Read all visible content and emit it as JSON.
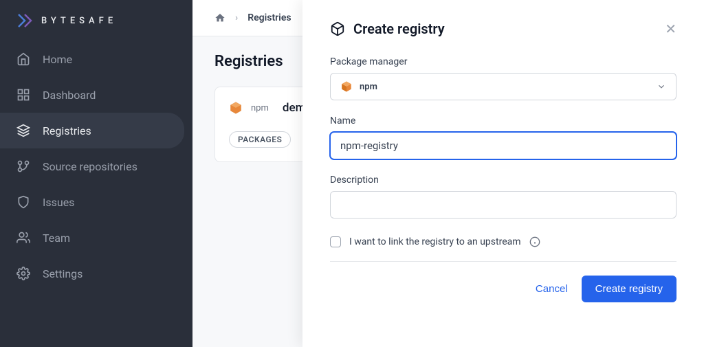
{
  "brand": {
    "name": "BYTESAFE"
  },
  "sidebar": {
    "items": [
      {
        "label": "Home",
        "icon": "home"
      },
      {
        "label": "Dashboard",
        "icon": "dashboard"
      },
      {
        "label": "Registries",
        "icon": "layers",
        "active": true
      },
      {
        "label": "Source repositories",
        "icon": "branch"
      },
      {
        "label": "Issues",
        "icon": "shield"
      },
      {
        "label": "Team",
        "icon": "users"
      },
      {
        "label": "Settings",
        "icon": "gear"
      }
    ]
  },
  "breadcrumb": {
    "current": "Registries"
  },
  "page": {
    "title": "Registries"
  },
  "registry_card": {
    "type_label": "npm",
    "name": "demo",
    "badge": "PACKAGES"
  },
  "modal": {
    "title": "Create registry",
    "fields": {
      "package_manager": {
        "label": "Package manager",
        "value": "npm"
      },
      "name": {
        "label": "Name",
        "value": "npm-registry"
      },
      "description": {
        "label": "Description",
        "value": ""
      },
      "upstream": {
        "label": "I want to link the registry to an upstream"
      }
    },
    "actions": {
      "cancel": "Cancel",
      "submit": "Create registry"
    }
  }
}
